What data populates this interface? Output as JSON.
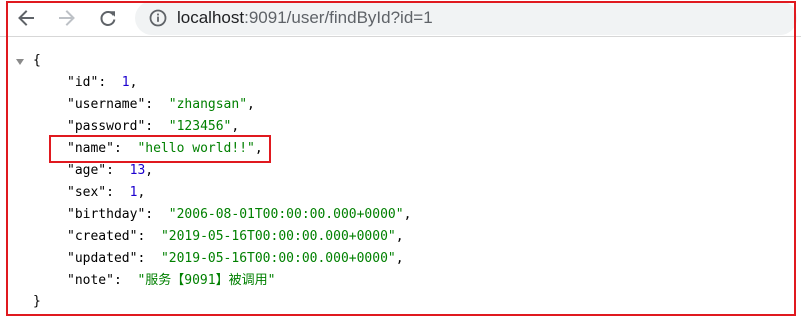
{
  "toolbar": {
    "back_icon": "arrow-left-icon",
    "forward_icon": "arrow-right-icon",
    "reload_icon": "reload-icon",
    "info_icon": "info-icon",
    "url_host": "localhost",
    "url_rest": ":9091/user/findById?id=1"
  },
  "json": {
    "open_brace": "{",
    "close_brace": "}",
    "entries": [
      {
        "key": "\"id\"",
        "value": "1",
        "type": "number",
        "comma": ","
      },
      {
        "key": "\"username\"",
        "value": "\"zhangsan\"",
        "type": "string",
        "comma": ","
      },
      {
        "key": "\"password\"",
        "value": "\"123456\"",
        "type": "string",
        "comma": ","
      },
      {
        "key": "\"name\"",
        "value": "\"hello world!!\"",
        "type": "string",
        "comma": ","
      },
      {
        "key": "\"age\"",
        "value": "13",
        "type": "number",
        "comma": ","
      },
      {
        "key": "\"sex\"",
        "value": "1",
        "type": "number",
        "comma": ","
      },
      {
        "key": "\"birthday\"",
        "value": "\"2006-08-01T00:00:00.000+0000\"",
        "type": "string",
        "comma": ","
      },
      {
        "key": "\"created\"",
        "value": "\"2019-05-16T00:00:00.000+0000\"",
        "type": "string",
        "comma": ","
      },
      {
        "key": "\"updated\"",
        "value": "\"2019-05-16T00:00:00.000+0000\"",
        "type": "string",
        "comma": ","
      },
      {
        "key": "\"note\"",
        "value": "\"服务【9091】被调用\"",
        "type": "string",
        "comma": ""
      }
    ]
  },
  "colors": {
    "highlight": "#e0191f",
    "number": "#1c00cf",
    "string": "#008000"
  }
}
